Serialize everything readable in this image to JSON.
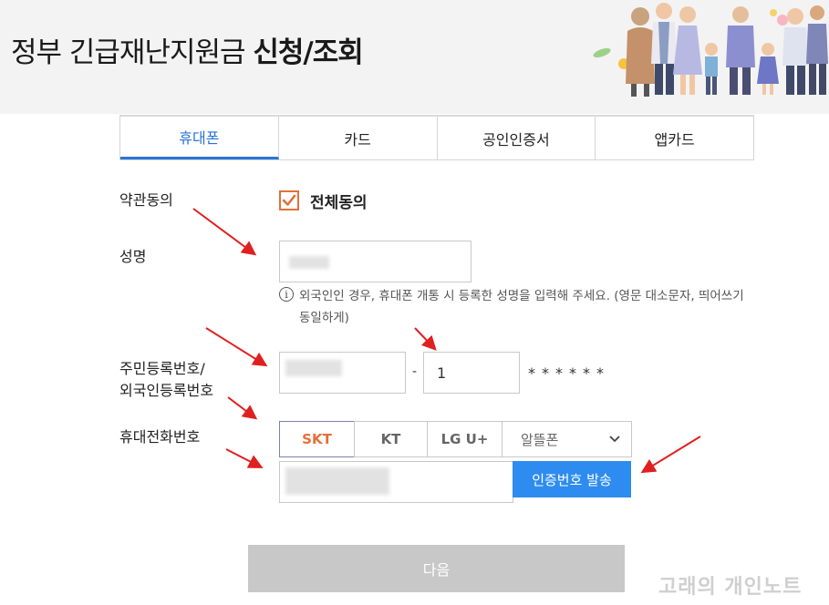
{
  "header": {
    "title_normal": "정부 긴급재난지원금 ",
    "title_bold": "신청/조회"
  },
  "tabs": [
    {
      "label": "휴대폰",
      "active": true
    },
    {
      "label": "카드",
      "active": false
    },
    {
      "label": "공인인증서",
      "active": false
    },
    {
      "label": "앱카드",
      "active": false
    }
  ],
  "form": {
    "terms_label": "약관동의",
    "agree_all_label": "전체동의",
    "agree_all_checked": true,
    "name_label": "성명",
    "name_hint": "외국인인 경우, 휴대폰 개통 시 등록한 성명을 입력해 주세요. (영문 대소문자, 띄어쓰기 동일하게)",
    "rrn_label_line1": "주민등록번호/",
    "rrn_label_line2": "외국인등록번호",
    "rrn_separator": "-",
    "rrn_back_value": "1",
    "rrn_masked": "******",
    "phone_label": "휴대전화번호",
    "carriers": [
      "SKT",
      "KT",
      "LG U+"
    ],
    "carrier_selected": "SKT",
    "mvno_select": "알뜰폰",
    "send_code_button": "인증번호 발송"
  },
  "next_button": "다음",
  "watermark": "고래의 개인노트",
  "colors": {
    "accent_blue": "#2a73d8",
    "send_button": "#2e8cf0",
    "checkbox_orange": "#e2703a",
    "disabled_gray": "#c8c8c8",
    "annotation_red": "#e02020"
  }
}
